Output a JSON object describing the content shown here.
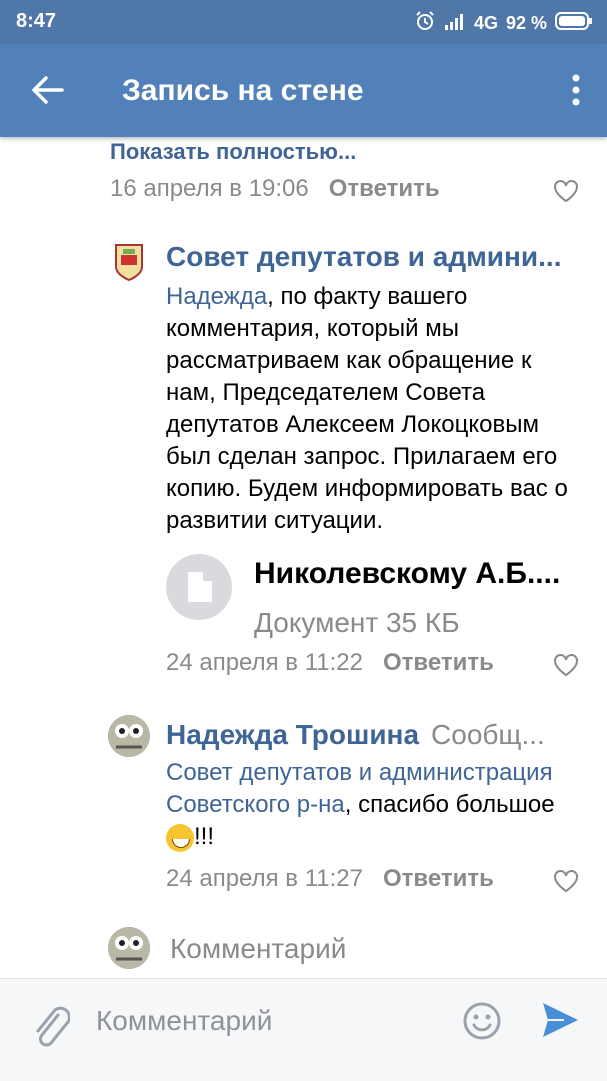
{
  "status_bar": {
    "time": "8:47",
    "network": "4G",
    "battery": "92 %"
  },
  "app_bar": {
    "title": "Запись на стене"
  },
  "previous_comment": {
    "show_full": "Показать полностью...",
    "date": "16 апреля в 19:06",
    "reply": "Ответить"
  },
  "comments": [
    {
      "author": "Совет депутатов и админи...",
      "mention": "Надежда",
      "text": ", по факту вашего комментария, который мы рассматриваем как обращение к нам, Председателем Совета депутатов Алексеем Локоцковым был сделан запрос. Прилагаем его копию. Будем информировать вас о развитии ситуации.",
      "attachment": {
        "name": "Николевскому А.Б....",
        "meta": "Документ 35 КБ"
      },
      "date": "24 апреля в 11:22",
      "reply": "Ответить"
    },
    {
      "author": "Надежда Трошина",
      "badge": "Сообщ...",
      "mention_line1": "Совет депутатов и администрация",
      "mention_line2": "Советского р-на",
      "text": ", спасибо большое",
      "emoji_suffix": "!!!",
      "date": "24 апреля в 11:27",
      "reply": "Ответить"
    }
  ],
  "inline_comment": {
    "placeholder": "Комментарий"
  },
  "bottom_bar": {
    "placeholder": "Комментарий"
  },
  "colors": {
    "app_bar": "#5181b8",
    "status_bar": "#4f77a8",
    "link": "#3f6596",
    "secondary_text": "#8a8a8a",
    "send": "#4a8fd6"
  }
}
